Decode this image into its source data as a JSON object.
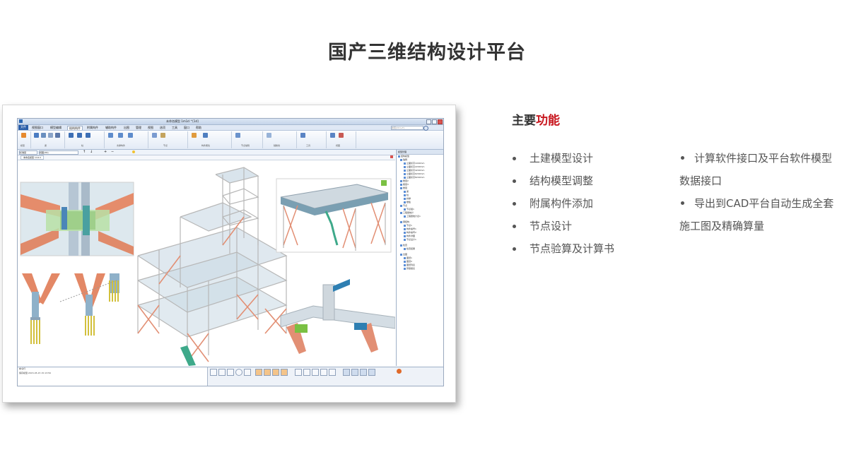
{
  "page_title": "国产三维结构设计平台",
  "features": {
    "heading_prefix": "主要",
    "heading_accent": "功能",
    "left_items": [
      "土建模型设计",
      "结构模型调整",
      "附属构件添加",
      "节点设计",
      "节点验算及计算书"
    ],
    "right_items": [
      {
        "line1": "计算软件接口及平台软件模型",
        "line2": "数据接口"
      },
      {
        "line1": "导出到CAD平台自动生成全套",
        "line2": "施工图及精确算量"
      }
    ],
    "accent_color": "#c8161e"
  },
  "screenshot": {
    "window_title": "未命名模型 1m1d ^[1d]",
    "file_tab": "文件",
    "menu_tabs": [
      "视图窗口",
      "模型编辑",
      "结构构件",
      "附属构件",
      "辅助构件",
      "出图",
      "管理",
      "视图",
      "选项",
      "工具",
      "窗口",
      "帮助"
    ],
    "active_tab_index": 2,
    "search_placeholder": "搜索(Ctrl+F)",
    "ribbon_groups": [
      "模型",
      "梁",
      "柱",
      "支撑构件",
      "节点",
      "构件属性",
      "节点编辑",
      "辅助线",
      "工具",
      "视图"
    ],
    "doc_tab": "未命名模型 1m1d",
    "layer_select": "标准层",
    "view_select": "视图(3D)",
    "tree_title": "模型管理",
    "tree_items": [
      "结构模型",
      "轴网",
      "立面标高1000mm",
      "立面标高2200mm",
      "立面标高4200mm",
      "立面标高6200mm",
      "立面标高8200mm",
      "楼层2",
      "楼层3",
      "楼层",
      "梁",
      "柱",
      "斜撑",
      "楼板",
      "节点",
      "节点组1",
      "工程量统计",
      "工程量统计表1",
      "钢结构",
      "节点1",
      "构件编号1",
      "构件编号2",
      "构件详图",
      "节点设计1",
      "检查",
      "检查结果",
      "出图",
      "图纸1",
      "图纸2",
      "图纸列表",
      "算量报表"
    ],
    "log_title": "命令行",
    "log_line": "保存模型:2015-05-15 15:13:56"
  }
}
